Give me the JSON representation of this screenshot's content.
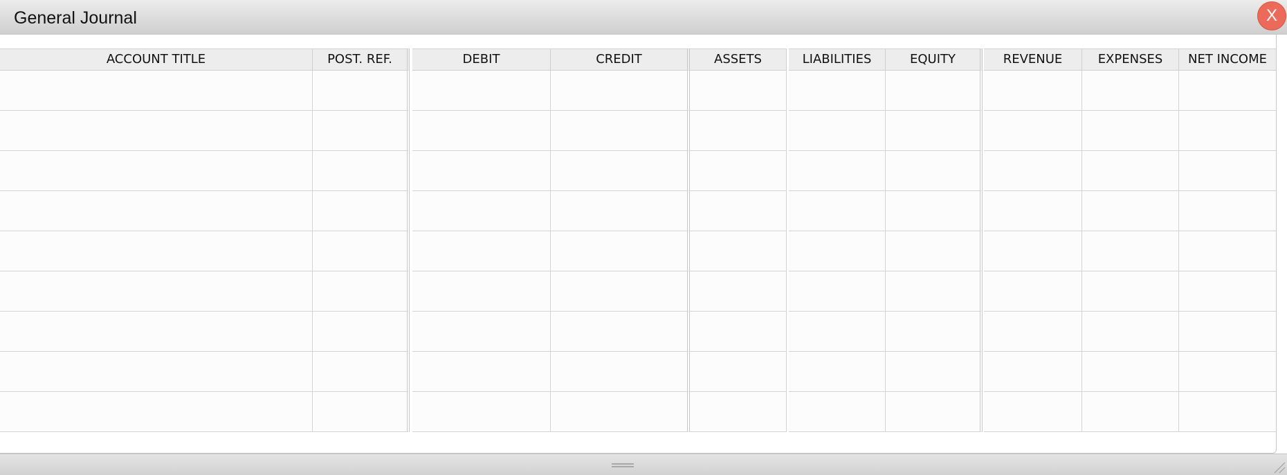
{
  "window": {
    "title": "General Journal",
    "close_label": "X"
  },
  "table": {
    "columns": [
      "ACCOUNT TITLE",
      "POST. REF.",
      "DEBIT",
      "CREDIT",
      "ASSETS",
      "LIABILITIES",
      "EQUITY",
      "REVENUE",
      "EXPENSES",
      "NET INCOME"
    ],
    "rows": [
      [
        "",
        "",
        "",
        "",
        "",
        "",
        "",
        "",
        "",
        ""
      ],
      [
        "",
        "",
        "",
        "",
        "",
        "",
        "",
        "",
        "",
        ""
      ],
      [
        "",
        "",
        "",
        "",
        "",
        "",
        "",
        "",
        "",
        ""
      ],
      [
        "",
        "",
        "",
        "",
        "",
        "",
        "",
        "",
        "",
        ""
      ],
      [
        "",
        "",
        "",
        "",
        "",
        "",
        "",
        "",
        "",
        ""
      ],
      [
        "",
        "",
        "",
        "",
        "",
        "",
        "",
        "",
        "",
        ""
      ],
      [
        "",
        "",
        "",
        "",
        "",
        "",
        "",
        "",
        "",
        ""
      ],
      [
        "",
        "",
        "",
        "",
        "",
        "",
        "",
        "",
        "",
        ""
      ],
      [
        "",
        "",
        "",
        "",
        "",
        "",
        "",
        "",
        "",
        ""
      ]
    ]
  },
  "icons": {
    "close": "close-icon",
    "drag_handle": "drag-handle-icon",
    "resize_grip": "resize-grip-icon"
  },
  "colors": {
    "close_button": "#ec6a5a",
    "header_background": "#ededed",
    "grid_line": "#d4d4d4"
  }
}
